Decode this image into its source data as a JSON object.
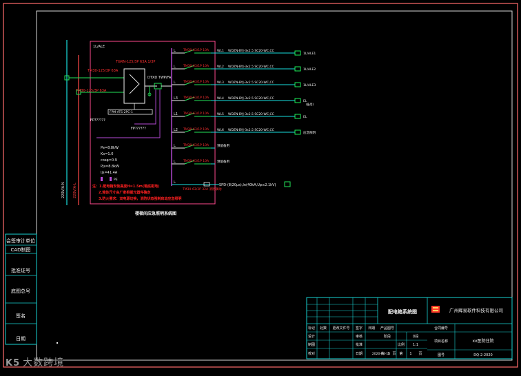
{
  "colors": {
    "background": "#000000",
    "frame_outer": "#ff6c6c",
    "frame_inner": "#d8d8d8",
    "busbar": "#19e0e0",
    "breaker": "#23e65a",
    "mcc_border": "#ff4a8e",
    "note_red": "#ff2020",
    "label_red": "#ff3030",
    "device_white": "#f2f2f2",
    "control_purple": "#b84ad8",
    "terminal_green": "#1cf25a",
    "title_cyan": "#19d3d3",
    "title_text": "#f2f2f2",
    "logo_red": "#ff3a2a"
  },
  "left_stamp_cells": [
    "会签审计单位",
    "CAD制图",
    "批准证号",
    "底图总号",
    "签名",
    "日期"
  ],
  "panel": {
    "name": "1L/ALE",
    "ats_label": "ATS(3P)",
    "spd_label": "FPM-ATS-2PC-1",
    "drawing_caption": "楼梯间应急照明系统图",
    "incoming_left": "220V/A-N",
    "incoming_right": "220V/A-L",
    "breaker_main_a": "TM30-125/3P 63A",
    "breaker_main_b": "TM30-125/3P 63A",
    "ats_top": "TGRN-125/3P 63A 1/3P",
    "ats_spec": "DTXD TWP/FA",
    "fiber_a": "FP??????",
    "fiber_b": "FP??????",
    "params": [
      "Pe=8.8kW",
      "Kx=1.0",
      "cosφ=0.9",
      "Pjs=8.8kW",
      "Ijs=41.4A"
    ],
    "legend_tag": "PE",
    "notes": [
      "注：1.配电箱安装高度H=1.5m(箱底距地)",
      "2.箱体尺寸由厂家根据元器件确定",
      "3.防火要求：双电源切换，消防状态强制启动应急照明"
    ]
  },
  "circuits": [
    {
      "tag": "L",
      "breaker": "TM30-63/1P 10A",
      "code": "WL1",
      "cable": "WDZN-BYJ-3x2.5 SC20-WC,CC",
      "load": "1L/ALE1"
    },
    {
      "tag": "L",
      "breaker": "TM30-63/1P 10A",
      "code": "WL2",
      "cable": "WDZN-BYJ-3x2.5 SC20-WC,CC",
      "load": "1L/ALE2"
    },
    {
      "tag": "L",
      "breaker": "TM30-63/1P 10A",
      "code": "WL3",
      "cable": "WDZN-BYJ-3x2.5 SC20-WC,CC",
      "load": "1L/ALE3"
    },
    {
      "tag": "L3",
      "breaker": "TM30-63/1P 10A",
      "code": "WL4",
      "cable": "WDZN-BYJ-3x2.5 SC20-WC,CC",
      "load": "EL"
    },
    {
      "tag": "L1",
      "breaker": "TM30-63/1P 10A",
      "code": "WL5",
      "cable": "WDZN-BYJ-3x2.5 SC20-WC,CC",
      "load": "EL"
    },
    {
      "tag": "L2",
      "breaker": "TM30-63/1P 10A",
      "code": "WL6",
      "cable": "WDZN-BYJ-3x2.5 SC20-WC,CC",
      "load": "应急照明"
    },
    {
      "tag": "L",
      "breaker": "TM30-63/1P 10A",
      "code": "",
      "cable": "预留备用",
      "load": ""
    },
    {
      "tag": "L",
      "breaker": "TM30-63/1P 10A",
      "code": "",
      "cable": "预留备用",
      "load": ""
    }
  ],
  "load_sub": "(备用)",
  "spd_circuit": {
    "tag": "L",
    "label": "SPD-(8/20μs),In(40kA,Up≤2.1kV)",
    "breaker": "TM30-63/3P 32A 消防联动"
  },
  "title_block": {
    "drawing_title": "配电箱系统图",
    "company": "广州辉易软件科技有限公司",
    "row_headers": [
      "标记",
      "处数",
      "更改文件号",
      "签字",
      "日期",
      "产品图号",
      "合同编号"
    ],
    "left_labels": [
      "设计",
      "制图",
      "校对"
    ],
    "mid_labels": [
      "审核",
      "批准",
      "日期"
    ],
    "date_value": "2020-04-16",
    "field_labels": [
      "阶段",
      "比例"
    ],
    "field_values": [
      "D段",
      "1:1"
    ],
    "sheet_text": [
      "共",
      "1",
      "页",
      "第",
      "1",
      "页"
    ],
    "project_label": "项目名称",
    "project_value": "xx医院住院",
    "figure_label": "图号",
    "figure_value": "DQ-2-2020"
  },
  "watermark": {
    "logo": "K5",
    "text": "大数跨境"
  }
}
